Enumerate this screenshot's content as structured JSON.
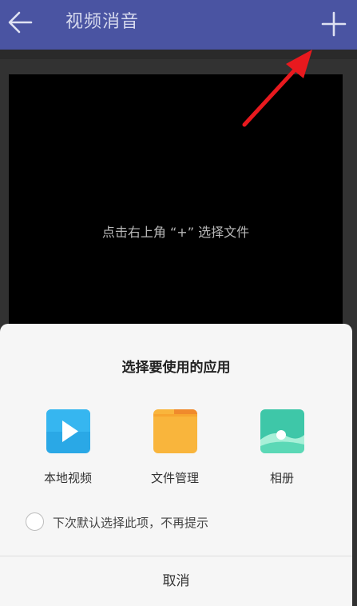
{
  "topbar": {
    "title": "视频消音",
    "back_icon": "arrow-left-icon",
    "add_icon": "plus-icon"
  },
  "preview": {
    "hint": "点击右上角 “+” 选择文件"
  },
  "sheet": {
    "title": "选择要使用的应用",
    "apps": [
      {
        "label": "本地视频",
        "icon": "play-video-icon"
      },
      {
        "label": "文件管理",
        "icon": "folder-icon"
      },
      {
        "label": "相册",
        "icon": "gallery-icon"
      }
    ],
    "default_option": "下次默认选择此项，不再提示",
    "cancel": "取消"
  },
  "colors": {
    "topbar": "#4a54a2",
    "annotation_arrow": "#e8191e",
    "video_icon": "#2aa8e6",
    "folder_icon": "#f9b53c",
    "gallery_icon": "#3ec7a8"
  }
}
